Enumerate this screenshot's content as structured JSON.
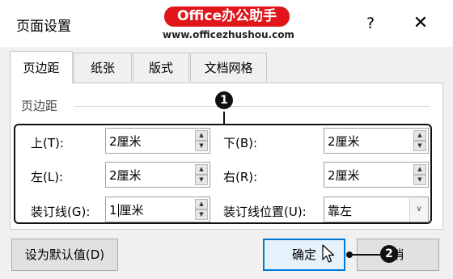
{
  "dialog": {
    "title": "页面设置",
    "help": "?",
    "close": "✕"
  },
  "watermark": {
    "brand": "Office办公助手",
    "url": "www.officezhushou.com"
  },
  "tabs": [
    {
      "label": "页边距",
      "active": true
    },
    {
      "label": "纸张",
      "active": false
    },
    {
      "label": "版式",
      "active": false
    },
    {
      "label": "文档网格",
      "active": false
    }
  ],
  "section": {
    "label": "页边距"
  },
  "annotations": {
    "one": "1",
    "two": "2"
  },
  "fields": {
    "top": {
      "label": "上(T):",
      "value": "2厘米"
    },
    "bottom": {
      "label": "下(B):",
      "value": "2厘米"
    },
    "left": {
      "label": "左(L):",
      "value": "2厘米"
    },
    "right": {
      "label": "右(R):",
      "value": "2厘米"
    },
    "gutter": {
      "label": "装订线(G):",
      "value_before_caret": "1",
      "value_after_caret": "厘米"
    },
    "gutter_position": {
      "label": "装订线位置(U):",
      "value": "靠左"
    }
  },
  "buttons": {
    "set_default": "设为默认值(D)",
    "ok": "确定",
    "cancel": "消"
  },
  "icons": {
    "spin_up": "▲",
    "spin_down": "▼",
    "dropdown": "∨"
  }
}
